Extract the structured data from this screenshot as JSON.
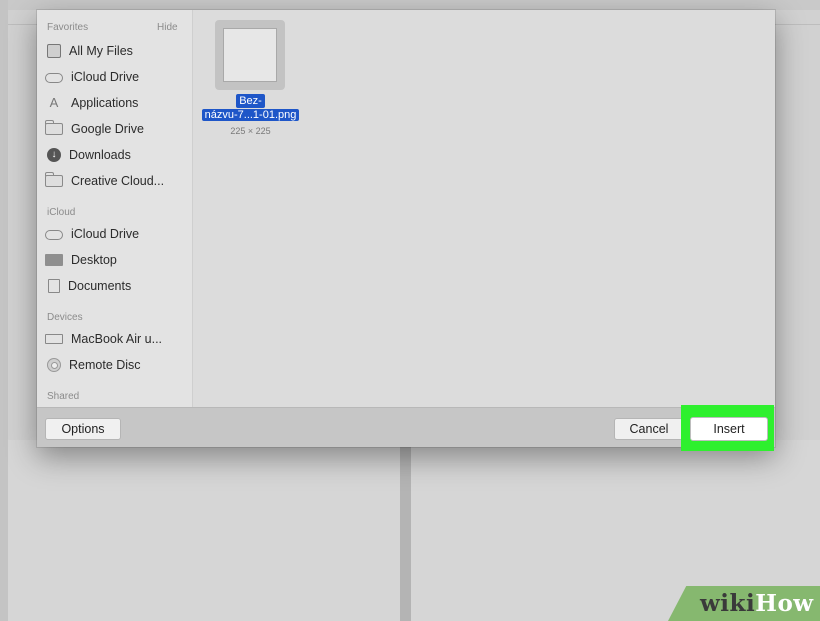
{
  "sidebar": {
    "favorites_header": "Favorites",
    "hide_label": "Hide",
    "favorites": [
      {
        "label": "All My Files",
        "icon": "all-files-icon"
      },
      {
        "label": "iCloud Drive",
        "icon": "cloud-icon"
      },
      {
        "label": "Applications",
        "icon": "applications-icon"
      },
      {
        "label": "Google Drive",
        "icon": "folder-icon"
      },
      {
        "label": "Downloads",
        "icon": "download-icon"
      },
      {
        "label": "Creative Cloud...",
        "icon": "folder-icon"
      }
    ],
    "icloud_header": "iCloud",
    "icloud": [
      {
        "label": "iCloud Drive",
        "icon": "cloud-icon"
      },
      {
        "label": "Desktop",
        "icon": "desktop-icon"
      },
      {
        "label": "Documents",
        "icon": "documents-icon"
      }
    ],
    "devices_header": "Devices",
    "devices": [
      {
        "label": "MacBook Air u...",
        "icon": "laptop-icon"
      },
      {
        "label": "Remote Disc",
        "icon": "disc-icon"
      }
    ],
    "shared_header": "Shared"
  },
  "file": {
    "name_line1": "Bez-",
    "name_line2": "názvu-7...1-01.png",
    "dimensions": "225 × 225"
  },
  "footer": {
    "options_label": "Options",
    "cancel_label": "Cancel",
    "insert_label": "Insert"
  },
  "watermark": {
    "wiki": "wiki",
    "how": "How"
  },
  "colors": {
    "selection": "#1e56c8",
    "highlight": "#2ef02e",
    "watermark_bg": "#86b86f"
  }
}
